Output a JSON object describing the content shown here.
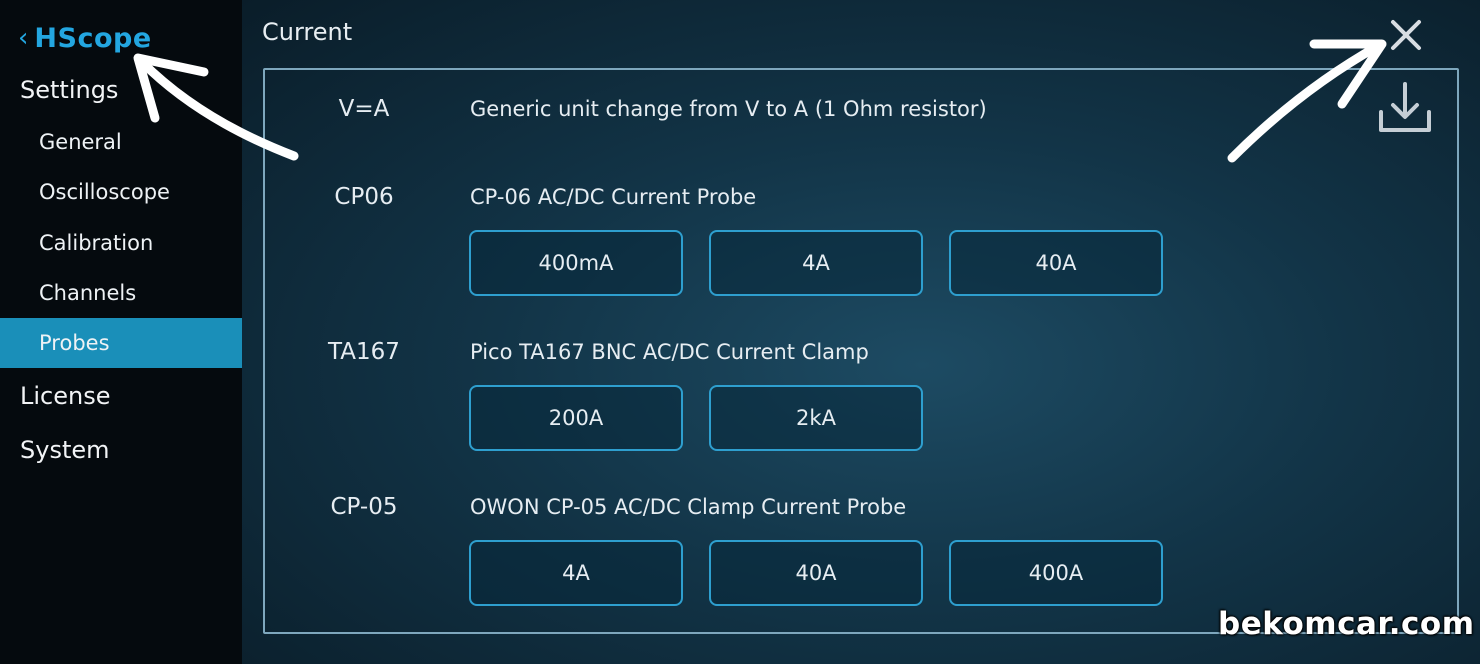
{
  "app": {
    "back_glyph": "‹",
    "name": "HScope"
  },
  "sidebar": {
    "settings_label": "Settings",
    "items": [
      {
        "label": "General",
        "active": false
      },
      {
        "label": "Oscilloscope",
        "active": false
      },
      {
        "label": "Calibration",
        "active": false
      },
      {
        "label": "Channels",
        "active": false
      },
      {
        "label": "Probes",
        "active": true
      }
    ],
    "license_label": "License",
    "system_label": "System"
  },
  "header": {
    "title": "Current",
    "close_icon": "close-icon",
    "download_icon": "download-icon"
  },
  "probes": [
    {
      "code": "V=A",
      "description": "Generic unit change from V to A (1 Ohm resistor)",
      "ranges": []
    },
    {
      "code": "CP06",
      "description": "CP-06 AC/DC Current Probe",
      "ranges": [
        "400mA",
        "4A",
        "40A"
      ]
    },
    {
      "code": "TA167",
      "description": "Pico TA167 BNC AC/DC Current Clamp",
      "ranges": [
        "200A",
        "2kA"
      ]
    },
    {
      "code": "CP-05",
      "description": "OWON CP-05 AC/DC Clamp Current Probe",
      "ranges": [
        "4A",
        "40A",
        "400A"
      ]
    }
  ],
  "watermark": "bekomcar.com",
  "colors": {
    "accent": "#23a6e0",
    "active_item_bg": "#1a8fb9",
    "button_border": "#2e9fcf",
    "panel_border": "#7ea7bd"
  }
}
